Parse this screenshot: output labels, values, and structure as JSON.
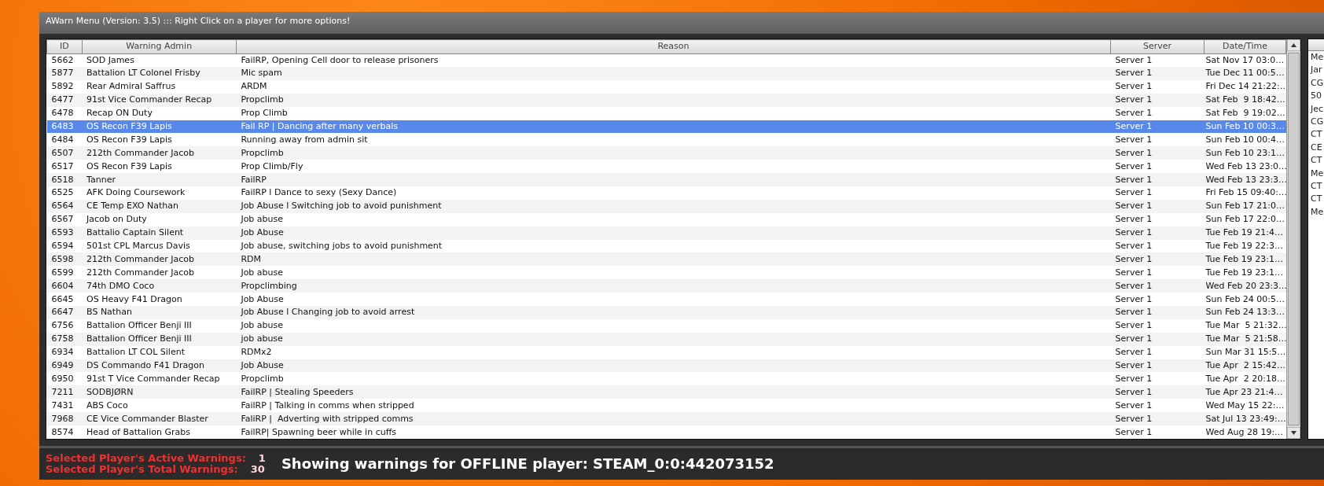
{
  "window": {
    "title": "AWarn Menu (Version: 3.5) ::: Right Click on a player for more options!"
  },
  "table": {
    "columns": [
      "ID",
      "Warning Admin",
      "Reason",
      "Server",
      "Date/Time"
    ],
    "rows": [
      {
        "id": "5662",
        "admin": "SOD James",
        "reason": "FailRP, Opening Cell door to release prisoners",
        "server": "Server 1",
        "datetime": "Sat Nov 17 03:0…",
        "selected": false
      },
      {
        "id": "5877",
        "admin": "Battalion LT Colonel Frisby",
        "reason": "Mic spam",
        "server": "Server 1",
        "datetime": "Tue Dec 11 00:5…",
        "selected": false
      },
      {
        "id": "5892",
        "admin": "Rear Admiral Saffrus",
        "reason": "ARDM",
        "server": "Server 1",
        "datetime": "Fri Dec 14 21:22:…",
        "selected": false
      },
      {
        "id": "6477",
        "admin": "91st Vice Commander Recap",
        "reason": "Propclimb",
        "server": "Server 1",
        "datetime": "Sat Feb  9 18:42…",
        "selected": false
      },
      {
        "id": "6478",
        "admin": "Recap ON Duty",
        "reason": "Prop Climb",
        "server": "Server 1",
        "datetime": "Sat Feb  9 19:02…",
        "selected": false
      },
      {
        "id": "6483",
        "admin": "OS Recon F39 Lapis",
        "reason": "Fail RP | Dancing after many verbals",
        "server": "Server 1",
        "datetime": "Sun Feb 10 00:3…",
        "selected": true
      },
      {
        "id": "6484",
        "admin": "OS Recon F39 Lapis",
        "reason": "Running away from admin sit",
        "server": "Server 1",
        "datetime": "Sun Feb 10 00:4…",
        "selected": false
      },
      {
        "id": "6507",
        "admin": "212th Commander Jacob",
        "reason": "Propclimb",
        "server": "Server 1",
        "datetime": "Sun Feb 10 23:1…",
        "selected": false
      },
      {
        "id": "6517",
        "admin": "OS Recon F39 Lapis",
        "reason": "Prop Climb/Fly",
        "server": "Server 1",
        "datetime": "Wed Feb 13 23:0…",
        "selected": false
      },
      {
        "id": "6518",
        "admin": "Tanner",
        "reason": "FailRP",
        "server": "Server 1",
        "datetime": "Wed Feb 13 23:3…",
        "selected": false
      },
      {
        "id": "6525",
        "admin": "AFK Doing Coursework",
        "reason": "FailRP l Dance to sexy (Sexy Dance)",
        "server": "Server 1",
        "datetime": "Fri Feb 15 09:40:…",
        "selected": false
      },
      {
        "id": "6564",
        "admin": "CE Temp EXO Nathan",
        "reason": "Job Abuse l Switching job to avoid punishment",
        "server": "Server 1",
        "datetime": "Sun Feb 17 21:0…",
        "selected": false
      },
      {
        "id": "6567",
        "admin": "Jacob on Duty",
        "reason": "Job abuse",
        "server": "Server 1",
        "datetime": "Sun Feb 17 22:0…",
        "selected": false
      },
      {
        "id": "6593",
        "admin": "Battalio Captain Silent",
        "reason": "Job Abuse",
        "server": "Server 1",
        "datetime": "Tue Feb 19 21:4…",
        "selected": false
      },
      {
        "id": "6594",
        "admin": "501st CPL Marcus Davis",
        "reason": "Job abuse, switching jobs to avoid punishment",
        "server": "Server 1",
        "datetime": "Tue Feb 19 22:3…",
        "selected": false
      },
      {
        "id": "6598",
        "admin": "212th Commander Jacob",
        "reason": "RDM",
        "server": "Server 1",
        "datetime": "Tue Feb 19 23:1…",
        "selected": false
      },
      {
        "id": "6599",
        "admin": "212th Commander Jacob",
        "reason": "Job abuse",
        "server": "Server 1",
        "datetime": "Tue Feb 19 23:1…",
        "selected": false
      },
      {
        "id": "6604",
        "admin": "74th DMO Coco",
        "reason": "Propclimbing",
        "server": "Server 1",
        "datetime": "Wed Feb 20 23:3…",
        "selected": false
      },
      {
        "id": "6645",
        "admin": "OS Heavy F41 Dragon",
        "reason": "Job Abuse",
        "server": "Server 1",
        "datetime": "Sun Feb 24 00:5…",
        "selected": false
      },
      {
        "id": "6647",
        "admin": "BS Nathan",
        "reason": "Job Abuse l Changing job to avoid arrest",
        "server": "Server 1",
        "datetime": "Sun Feb 24 13:3…",
        "selected": false
      },
      {
        "id": "6756",
        "admin": "Battalion Officer Benji III",
        "reason": "Job abuse",
        "server": "Server 1",
        "datetime": "Tue Mar  5 21:32…",
        "selected": false
      },
      {
        "id": "6758",
        "admin": "Battalion Officer Benji III",
        "reason": "job abuse",
        "server": "Server 1",
        "datetime": "Tue Mar  5 21:58…",
        "selected": false
      },
      {
        "id": "6934",
        "admin": "Battalion LT COL Silent",
        "reason": "RDMx2",
        "server": "Server 1",
        "datetime": "Sun Mar 31 15:5…",
        "selected": false
      },
      {
        "id": "6949",
        "admin": "DS Commando F41 Dragon",
        "reason": "Job Abuse",
        "server": "Server 1",
        "datetime": "Tue Apr  2 15:42…",
        "selected": false
      },
      {
        "id": "6950",
        "admin": "91st T Vice Commander Recap",
        "reason": "Propclimb",
        "server": "Server 1",
        "datetime": "Tue Apr  2 20:18…",
        "selected": false
      },
      {
        "id": "7211",
        "admin": "SODBJØRN",
        "reason": "FailRP | Stealing Speeders",
        "server": "Server 1",
        "datetime": "Tue Apr 23 21:4…",
        "selected": false
      },
      {
        "id": "7431",
        "admin": "ABS Coco",
        "reason": "FailRP | Talking in comms when stripped",
        "server": "Server 1",
        "datetime": "Wed May 15 22:…",
        "selected": false
      },
      {
        "id": "7968",
        "admin": "CE Vice Commander Blaster",
        "reason": "FaliRP |  Adverting with stripped comms",
        "server": "Server 1",
        "datetime": "Sat Jul 13 23:49:…",
        "selected": false
      },
      {
        "id": "8574",
        "admin": "Head of Battalion Grabs",
        "reason": "FailRP| Spawning beer while in cuffs",
        "server": "Server 1",
        "datetime": "Wed Aug 28 19:…",
        "selected": false
      }
    ]
  },
  "side_list": {
    "items": [
      "Me",
      "Jar",
      "CG",
      "50",
      "Jec",
      "CG",
      "CT",
      "CE",
      "CT",
      "Me",
      "CT",
      "CT",
      "Me"
    ]
  },
  "status_bar": {
    "active_label": "Selected Player's Active Warnings:",
    "active_value": "1",
    "total_label": "Selected Player's Total Warnings:",
    "total_value": "30",
    "message": "Showing warnings for OFFLINE player: STEAM_0:0:442073152"
  }
}
